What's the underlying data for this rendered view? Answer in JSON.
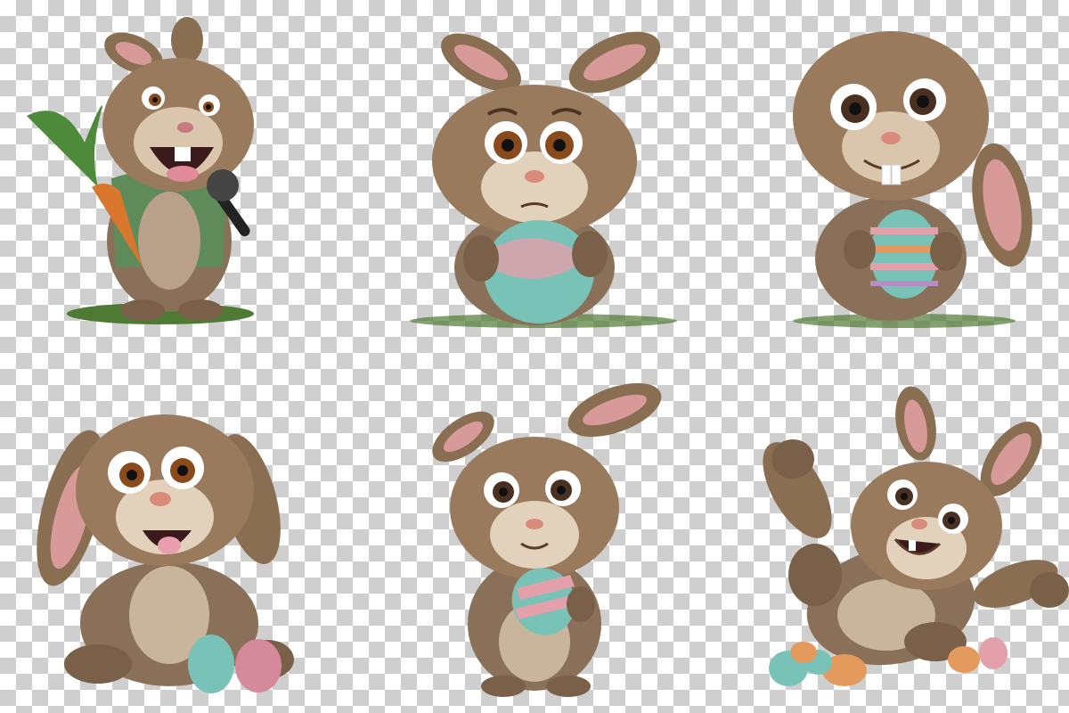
{
  "background": {
    "pattern": "transparency-checkerboard",
    "colors": [
      "#ffffff",
      "#cfcfcf"
    ]
  },
  "palette": {
    "fur_dark": "#6b5440",
    "fur_mid": "#9a7a5c",
    "fur_light": "#d9c6ad",
    "inner_ear": "#d79a98",
    "eye_iris": "#8a4a1c",
    "grass": "#4f7a33",
    "jacket": "#5f8a5a",
    "carrot": "#d9772e",
    "carrot_leaves": "#4d8a3a",
    "egg_mint": "#79c2b8",
    "egg_pink": "#e3a0ab",
    "egg_orange": "#e49a5c"
  },
  "bunnies": [
    {
      "id": "singer",
      "props": [
        "carrot",
        "microphone",
        "green-jacket",
        "grass"
      ]
    },
    {
      "id": "worried-egg",
      "props": [
        "large-speckled-egg",
        "grass"
      ]
    },
    {
      "id": "striped-egg",
      "props": [
        "striped-egg",
        "grass"
      ]
    },
    {
      "id": "lop-eared",
      "props": [
        "mint-egg",
        "pink-egg"
      ]
    },
    {
      "id": "small-egg",
      "props": [
        "striped-egg"
      ]
    },
    {
      "id": "waving",
      "props": [
        "egg-pile"
      ]
    }
  ]
}
